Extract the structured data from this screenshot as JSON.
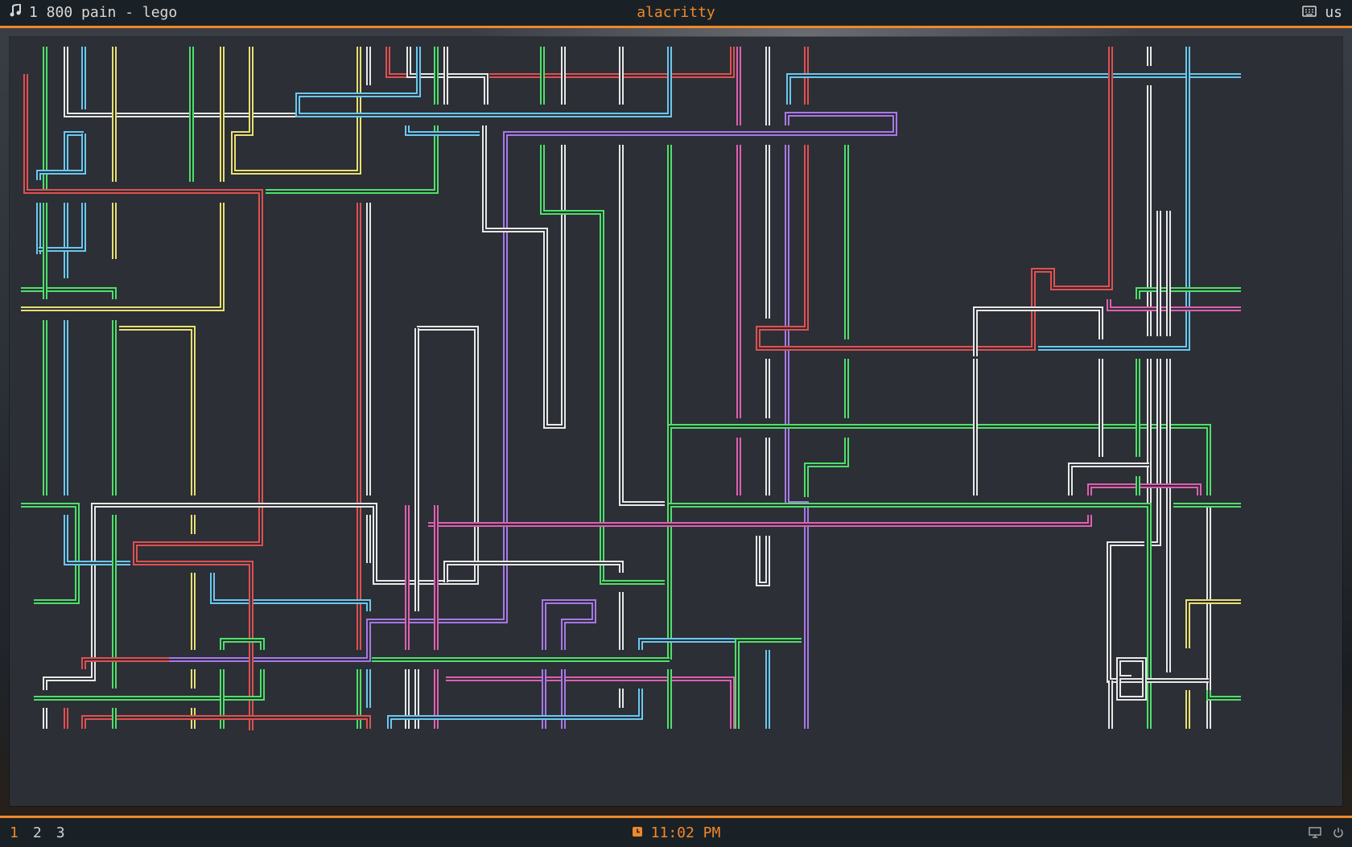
{
  "topbar": {
    "now_playing": "1 800 pain - lego",
    "window_title": "alacritty",
    "keyboard_layout": "us"
  },
  "bottombar": {
    "workspaces": [
      "1",
      "2",
      "3"
    ],
    "active_workspace": "1",
    "time": "11:02 PM"
  },
  "colors": {
    "accent": "#f0882a",
    "bar_bg": "#1a2126",
    "terminal_bg": "#2c2f36",
    "pipe_white": "#e8e8e8",
    "pipe_green": "#4ee06a",
    "pipe_red": "#e05050",
    "pipe_blue": "#6ac8f0",
    "pipe_yellow": "#e8e070",
    "pipe_purple": "#a878e8",
    "pipe_pink": "#e060b0"
  },
  "icons": {
    "music": "music-note-icon",
    "keyboard": "keyboard-icon",
    "clock": "clock-icon",
    "monitor": "monitor-icon",
    "power": "power-icon"
  }
}
